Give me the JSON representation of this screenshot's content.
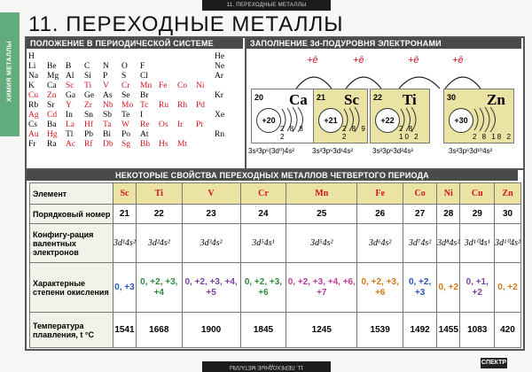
{
  "top_strip": "11. ПЕРЕХОДНЫЕ МЕТАЛЛЫ",
  "bottom_strip": "11. ПЕРЕХОДНЫЕ МЕТАЛЛЫ",
  "sidebar": "ХИМИЯ МЕТАЛЛЫ",
  "title": "11. ПЕРЕХОДНЫЕ МЕТАЛЛЫ",
  "left_header": "ПОЛОЖЕНИЕ В ПЕРИОДИЧЕСКОЙ СИСТЕМЕ",
  "right_header": "ЗАПОЛНЕНИЕ 3d-ПОДУРОВНЯ ЭЛЕКТРОНАМИ",
  "bottom_header": "НЕКОТОРЫЕ СВОЙСТВА ПЕРЕХОДНЫХ МЕТАЛЛОВ ЧЕТВЕРТОГО ПЕРИОДА",
  "periodic_rows": [
    [
      "H",
      "",
      "",
      "",
      "",
      "",
      "",
      "",
      "",
      "",
      "He"
    ],
    [
      "Li",
      "Be",
      "B",
      "C",
      "N",
      "O",
      "F",
      "",
      "",
      "",
      "Ne"
    ],
    [
      "Na",
      "Mg",
      "Al",
      "Si",
      "P",
      "S",
      "Cl",
      "",
      "",
      "",
      "Ar"
    ],
    [
      "K",
      "Ca",
      "Sc",
      "Ti",
      "V",
      "Cr",
      "Mn",
      "Fe",
      "Co",
      "Ni",
      ""
    ],
    [
      "Cu",
      "Zn",
      "Ga",
      "Ge",
      "As",
      "Se",
      "Br",
      "",
      "",
      "",
      "Kr"
    ],
    [
      "Rb",
      "Sr",
      "Y",
      "Zr",
      "Nb",
      "Mo",
      "Tc",
      "Ru",
      "Rh",
      "Pd",
      ""
    ],
    [
      "Ag",
      "Cd",
      "In",
      "Sn",
      "Sb",
      "Te",
      "I",
      "",
      "",
      "",
      "Xe"
    ],
    [
      "Cs",
      "Ba",
      "La",
      "Hf",
      "Ta",
      "W",
      "Re",
      "Os",
      "Ir",
      "Pt",
      ""
    ],
    [
      "Au",
      "Hg",
      "Tl",
      "Pb",
      "Bi",
      "Po",
      "At",
      "",
      "",
      "",
      "Rn"
    ],
    [
      "Fr",
      "Ra",
      "Ac",
      "Rf",
      "Db",
      "Sg",
      "Bh",
      "Hs",
      "Mt",
      "",
      ""
    ]
  ],
  "red_elements": [
    "Sc",
    "Ti",
    "V",
    "Cr",
    "Mn",
    "Fe",
    "Co",
    "Ni",
    "Cu",
    "Zn",
    "Y",
    "Zr",
    "Nb",
    "Mo",
    "Tc",
    "Ru",
    "Rh",
    "Pd",
    "Ag",
    "Cd",
    "La",
    "Hf",
    "Ta",
    "W",
    "Re",
    "Os",
    "Ir",
    "Pt",
    "Au",
    "Hg",
    "Ac",
    "Rf",
    "Db",
    "Sg",
    "Bh",
    "Hs",
    "Mt"
  ],
  "plus_e": "+ē",
  "atoms": [
    {
      "num": "20",
      "sym": "Ca",
      "nuc": "+20",
      "shells": "2 8 8 2"
    },
    {
      "num": "21",
      "sym": "Sc",
      "nuc": "+21",
      "shells": "2 8 9 2"
    },
    {
      "num": "22",
      "sym": "Ti",
      "nuc": "+22",
      "shells": "2 8 10 2"
    },
    {
      "num": "30",
      "sym": "Zn",
      "nuc": "+30",
      "shells": "2 8 18 2"
    }
  ],
  "configs": [
    "3s²3p⁶(3d⁰)4s²",
    "3s²3p⁶3d¹4s²",
    "3s²3p⁶3d²4s²",
    "3s²3p⁶3d¹⁰4s²"
  ],
  "table": {
    "labels": [
      "Элемент",
      "Порядковый номер",
      "Конфигу-рация валентных электронов",
      "Характерные степени окисления",
      "Температура плавления, t °C"
    ],
    "elements": [
      "Sc",
      "Ti",
      "V",
      "Cr",
      "Mn",
      "Fe",
      "Co",
      "Ni",
      "Cu",
      "Zn"
    ],
    "numbers": [
      "21",
      "22",
      "23",
      "24",
      "25",
      "26",
      "27",
      "28",
      "29",
      "30"
    ],
    "configs": [
      "3d¹4s²",
      "3d²4s²",
      "3d³4s²",
      "3d⁵4s¹",
      "3d⁵4s²",
      "3d⁶4s²",
      "3d⁷4s²",
      "3d⁸4s²",
      "3d¹⁰4s¹",
      "3d¹⁰4s²"
    ],
    "oxidation": [
      "0, +3",
      "0, +2, +3, +4",
      "0, +2, +3, +4, +5",
      "0, +2, +3, +6",
      "0, +2, +3, +4, +6, +7",
      "0, +2, +3, +6",
      "0, +2, +3",
      "0, +2",
      "0, +1, +2",
      "0, +2"
    ],
    "melting": [
      "1541",
      "1668",
      "1900",
      "1845",
      "1245",
      "1539",
      "1492",
      "1455",
      "1083",
      "420"
    ]
  },
  "logo": "СПЕКТР"
}
